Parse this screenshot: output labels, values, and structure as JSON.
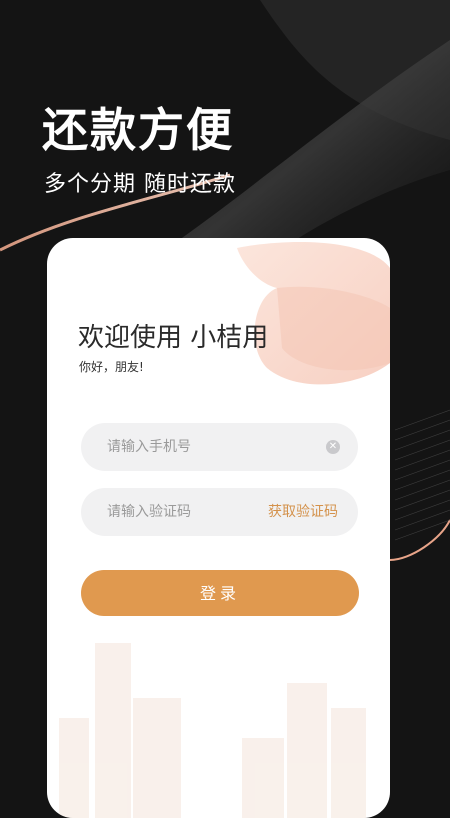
{
  "hero": {
    "title": "还款方便",
    "subtitle": "多个分期 随时还款"
  },
  "login_card": {
    "welcome": "欢迎使用 小桔用",
    "greeting": "你好，朋友!",
    "phone_placeholder": "请输入手机号",
    "code_placeholder": "请输入验证码",
    "get_code_label": "获取验证码",
    "login_label": "登录"
  },
  "colors": {
    "background": "#141414",
    "accent": "#e0994f",
    "link": "#d4924c",
    "field_bg": "#f1f1f2"
  },
  "icons": {
    "clear": "clear-circle-icon"
  }
}
